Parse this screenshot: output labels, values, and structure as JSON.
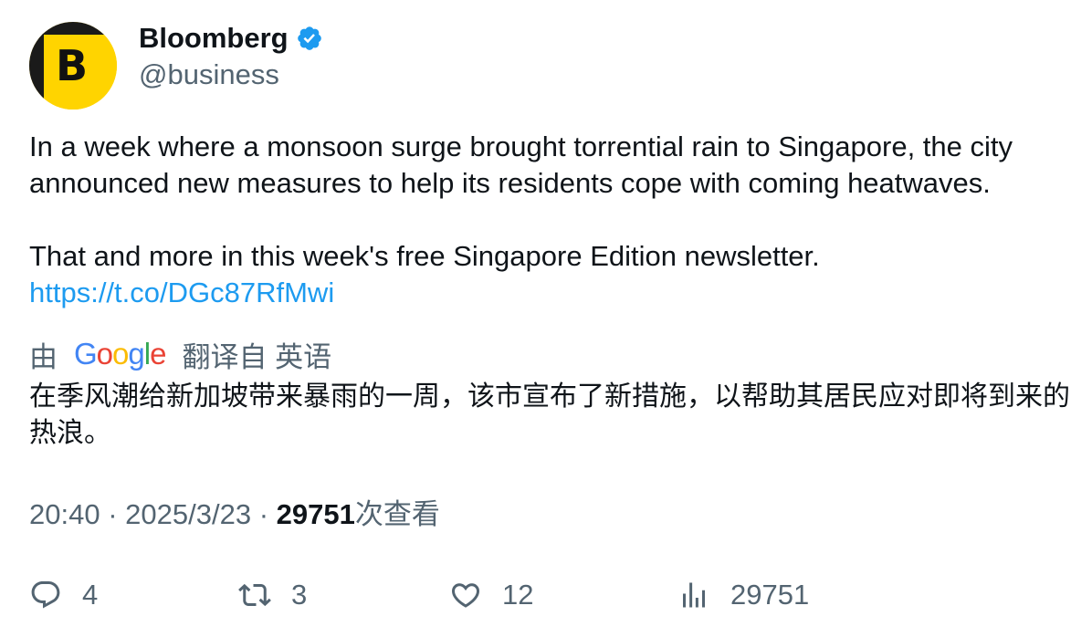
{
  "author": {
    "display_name": "Bloomberg",
    "handle": "@business",
    "avatar_letter": "B",
    "avatar_color": "#ffd400",
    "verified_color": "#1d9bf0"
  },
  "tweet": {
    "paragraph1": "In a week where a monsoon surge brought torrential rain to Singapore, the city announced new measures to help its residents cope with coming heatwaves.",
    "paragraph2": "That and more in this week's free Singapore Edition newsletter.",
    "link": "https://t.co/DGc87RfMwi"
  },
  "translation": {
    "prefix": "由",
    "provider": "Google",
    "suffix": "翻译自 英语",
    "text": "在季风潮给新加坡带来暴雨的一周，该市宣布了新措施，以帮助其居民应对即将到来的热浪。"
  },
  "meta": {
    "time": "20:40",
    "separator": "·",
    "date": "2025/3/23",
    "views_count": "29751",
    "views_label": "次查看"
  },
  "actions": {
    "replies": "4",
    "retweets": "3",
    "likes": "12",
    "views": "29751"
  },
  "colors": {
    "text": "#0f1419",
    "secondary": "#536471",
    "link": "#1d9bf0"
  }
}
